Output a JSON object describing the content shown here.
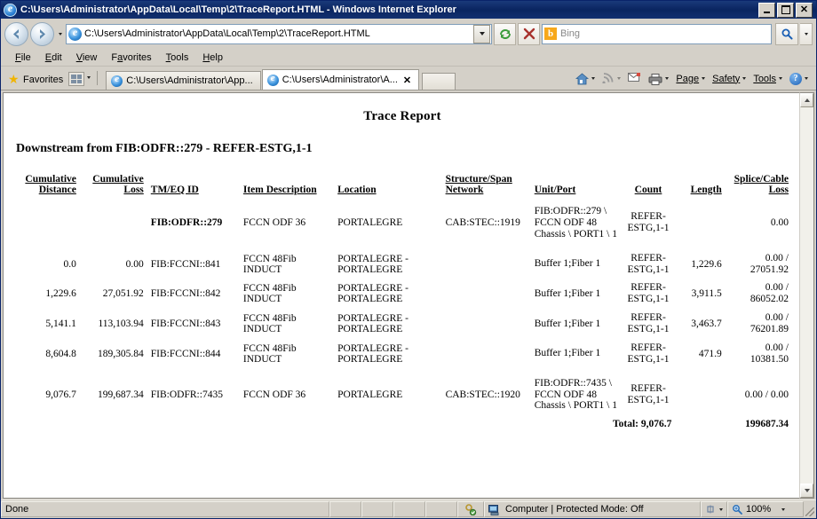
{
  "window": {
    "title": "C:\\Users\\Administrator\\AppData\\Local\\Temp\\2\\TraceReport.HTML - Windows Internet Explorer",
    "minimize_label": "Minimize",
    "maximize_label": "Maximize",
    "close_label": "Close"
  },
  "navbar": {
    "back_label": "Back",
    "forward_label": "Forward",
    "address_value": "C:\\Users\\Administrator\\AppData\\Local\\Temp\\2\\TraceReport.HTML",
    "refresh_label": "Refresh",
    "stop_label": "Stop",
    "search_placeholder": "Bing",
    "search_value": "",
    "search_button_label": "Search"
  },
  "menu": {
    "items": [
      {
        "label": "File",
        "accel": "F"
      },
      {
        "label": "Edit",
        "accel": "E"
      },
      {
        "label": "View",
        "accel": "V"
      },
      {
        "label": "Favorites",
        "accel": "a"
      },
      {
        "label": "Tools",
        "accel": "T"
      },
      {
        "label": "Help",
        "accel": "H"
      }
    ]
  },
  "commandbar": {
    "favorites_label": "Favorites",
    "home_label": "Home",
    "feeds_label": "Feeds",
    "mail_label": "Read mail",
    "print_label": "Print",
    "page_label": "Page",
    "safety_label": "Safety",
    "tools_label": "Tools",
    "help_label": "Help"
  },
  "tabs": [
    {
      "label": "C:\\Users\\Administrator\\App...",
      "active": false
    },
    {
      "label": "C:\\Users\\Administrator\\A...",
      "active": true,
      "close_label": "✕"
    }
  ],
  "report": {
    "title": "Trace Report",
    "subtitle": "Downstream from FIB:ODFR::279 - REFER-ESTG,1-1",
    "headers": {
      "cumulative_distance": "Cumulative Distance",
      "cumulative_loss": "Cumulative Loss",
      "tmeq_id": "TM/EQ ID",
      "item_description": "Item Description",
      "location": "Location",
      "structure_span": "Structure/Span Network",
      "unit_port": "Unit/Port",
      "count": "Count",
      "length": "Length",
      "splice_cable_loss": "Splice/Cable Loss"
    },
    "rows": [
      {
        "cumulative_distance": "",
        "cumulative_loss": "",
        "tmeq_id": "FIB:ODFR::279",
        "tmeq_bold": true,
        "item_description": "FCCN ODF 36",
        "location": "PORTALEGRE",
        "structure_span": "CAB:STEC::1919",
        "unit_port": "FIB:ODFR::279 \\ FCCN ODF 48 Chassis \\ PORT1 \\ 1",
        "count": "REFER-ESTG,1-1",
        "length": "",
        "splice_cable_loss": "0.00"
      },
      {
        "cumulative_distance": "0.0",
        "cumulative_loss": "0.00",
        "tmeq_id": "FIB:FCCNI::841",
        "tmeq_bold": false,
        "item_description": "FCCN 48Fib INDUCT",
        "location": "PORTALEGRE - PORTALEGRE",
        "structure_span": "",
        "unit_port": "Buffer 1;Fiber 1",
        "count": "REFER-ESTG,1-1",
        "length": "1,229.6",
        "splice_cable_loss": "0.00 /\n27051.92"
      },
      {
        "cumulative_distance": "1,229.6",
        "cumulative_loss": "27,051.92",
        "tmeq_id": "FIB:FCCNI::842",
        "tmeq_bold": false,
        "item_description": "FCCN 48Fib INDUCT",
        "location": "PORTALEGRE - PORTALEGRE",
        "structure_span": "",
        "unit_port": "Buffer 1;Fiber 1",
        "count": "REFER-ESTG,1-1",
        "length": "3,911.5",
        "splice_cable_loss": "0.00 /\n86052.02"
      },
      {
        "cumulative_distance": "5,141.1",
        "cumulative_loss": "113,103.94",
        "tmeq_id": "FIB:FCCNI::843",
        "tmeq_bold": false,
        "item_description": "FCCN 48Fib INDUCT",
        "location": "PORTALEGRE - PORTALEGRE",
        "structure_span": "",
        "unit_port": "Buffer 1;Fiber 1",
        "count": "REFER-ESTG,1-1",
        "length": "3,463.7",
        "splice_cable_loss": "0.00 /\n76201.89"
      },
      {
        "cumulative_distance": "8,604.8",
        "cumulative_loss": "189,305.84",
        "tmeq_id": "FIB:FCCNI::844",
        "tmeq_bold": false,
        "item_description": "FCCN 48Fib INDUCT",
        "location": "PORTALEGRE - PORTALEGRE",
        "structure_span": "",
        "unit_port": "Buffer 1;Fiber 1",
        "count": "REFER-ESTG,1-1",
        "length": "471.9",
        "splice_cable_loss": "0.00 /\n10381.50"
      },
      {
        "cumulative_distance": "9,076.7",
        "cumulative_loss": "199,687.34",
        "tmeq_id": "FIB:ODFR::7435",
        "tmeq_bold": false,
        "item_description": "FCCN ODF 36",
        "location": "PORTALEGRE",
        "structure_span": "CAB:STEC::1920",
        "unit_port": "FIB:ODFR::7435 \\ FCCN ODF 48 Chassis \\ PORT1 \\ 1",
        "count": "REFER-ESTG,1-1",
        "length": "",
        "splice_cable_loss": "0.00 / 0.00"
      }
    ],
    "total_label": "Total: 9,076.7",
    "total_loss": "199687.34"
  },
  "statusbar": {
    "status_text": "Done",
    "zone_text": "Computer | Protected Mode: Off",
    "zoom_text": "100%"
  }
}
